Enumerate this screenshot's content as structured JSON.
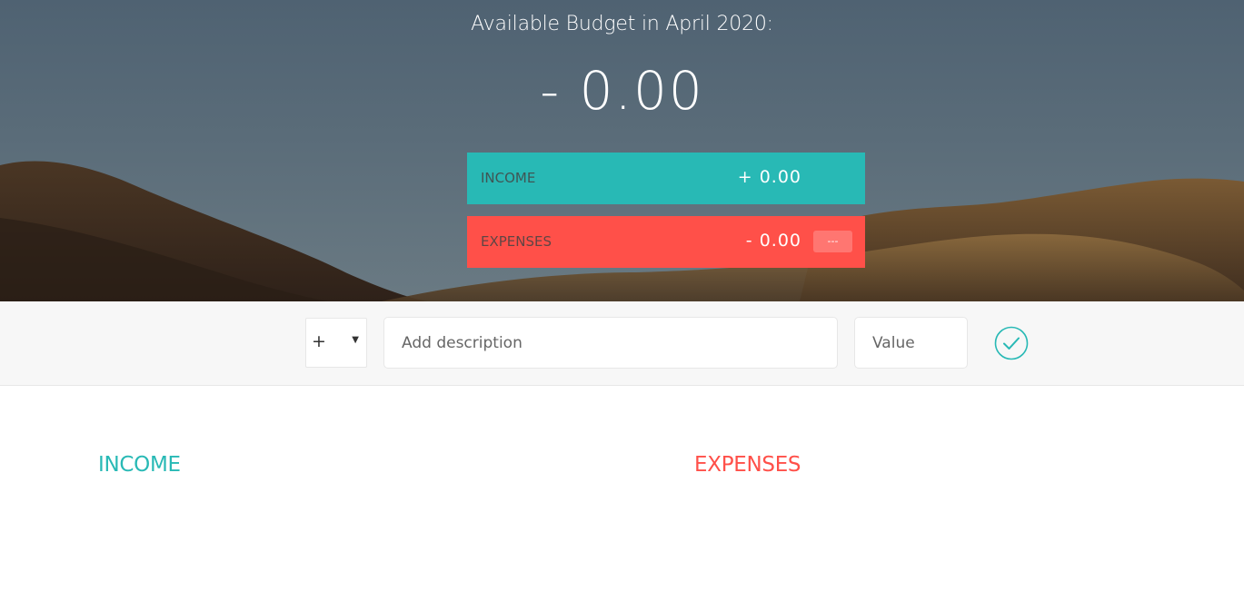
{
  "budget": {
    "title": "Available Budget in April 2020:",
    "value": "- 0.00"
  },
  "summary": {
    "income": {
      "label": "INCOME",
      "value": "+ 0.00"
    },
    "expenses": {
      "label": "EXPENSES",
      "value": "- 0.00",
      "percentage": "---"
    }
  },
  "add_bar": {
    "type_selected": "+",
    "description_placeholder": "Add description",
    "value_placeholder": "Value",
    "submit_icon": "checkmark-circle-icon"
  },
  "lists": {
    "income_title": "INCOME",
    "expenses_title": "EXPENSES"
  },
  "colors": {
    "income": "#28b9b5",
    "expenses": "#ff5049"
  }
}
